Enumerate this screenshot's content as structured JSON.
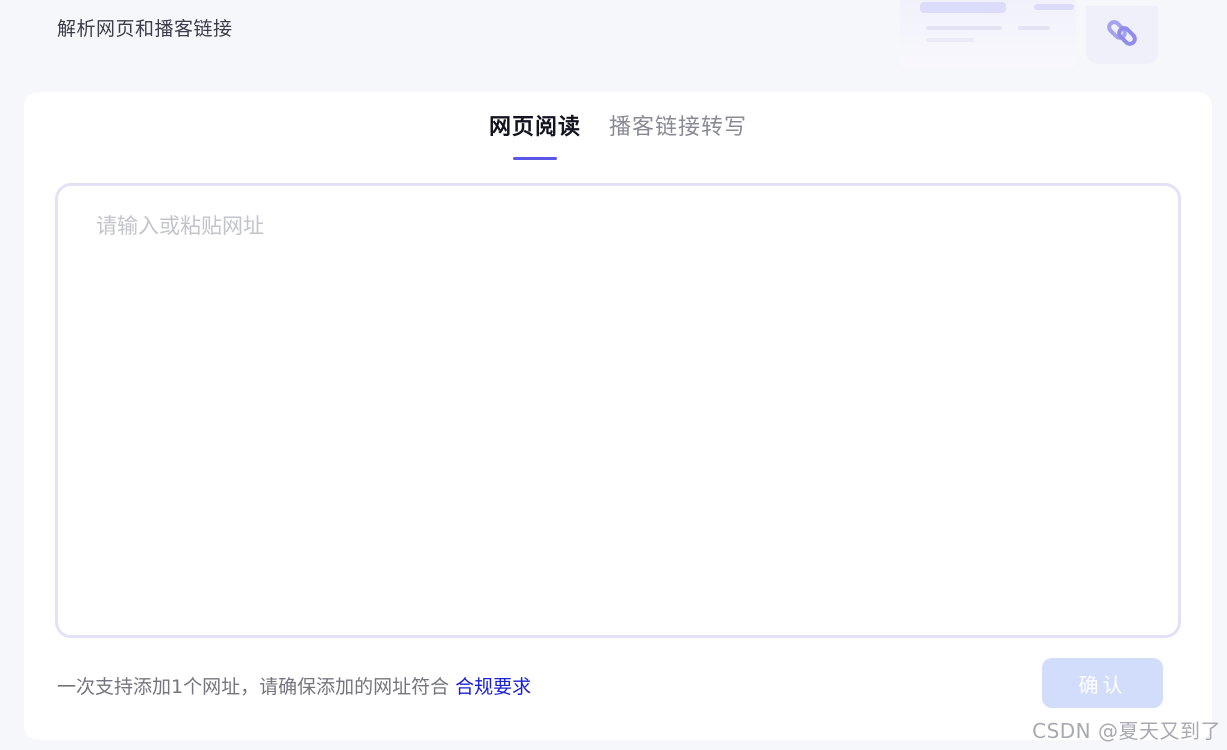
{
  "header": {
    "subtitle": "解析网页和播客链接"
  },
  "illustration": {
    "icon": "link-icon",
    "accent": "#a5a2f0"
  },
  "tabs": [
    {
      "label": "网页阅读",
      "active": true
    },
    {
      "label": "播客链接转写",
      "active": false
    }
  ],
  "url_input": {
    "placeholder": "请输入或粘贴网址",
    "value": ""
  },
  "footer": {
    "note": "一次支持添加1个网址，请确保添加的网址符合 ",
    "link_label": "合规要求"
  },
  "confirm_button": {
    "label": "确认",
    "color": "#d2dcfb"
  },
  "watermark": "CSDN @夏天又到了",
  "colors": {
    "accent": "#5a57e8",
    "link": "#1a20d8",
    "background": "#f6f7fb"
  }
}
